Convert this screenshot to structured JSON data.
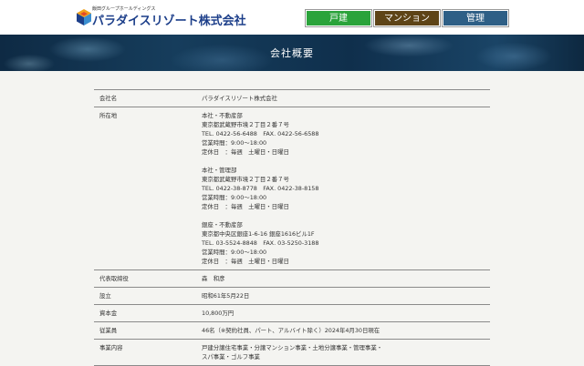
{
  "header": {
    "logo_sub": "飯田グループホールディングス",
    "logo_main": "パラダイスリゾート株式会社",
    "nav": [
      "戸建",
      "マンション",
      "管理"
    ]
  },
  "banner": {
    "title": "会社概要"
  },
  "table": {
    "rows": [
      {
        "label": "会社名",
        "value": "パラダイスリゾート株式会社"
      },
      {
        "label": "所在地",
        "offices": [
          {
            "lines": [
              "本社・不動産部",
              "東京都武蔵野市境２丁目２番７号",
              "TEL. 0422-56-6488　FAX. 0422-56-6588",
              "営業時間：9:00〜18:00",
              "定休日　：毎週　土曜日・日曜日"
            ]
          },
          {
            "lines": [
              "本社・管理部",
              "東京都武蔵野市境２丁目２番７号",
              "TEL. 0422-38-8778　FAX. 0422-38-8158",
              "営業時間：9:00〜18:00",
              "定休日　：毎週　土曜日・日曜日"
            ]
          },
          {
            "lines": [
              "銀座・不動産部",
              "東京都中央区銀座1-6-16 銀座1616ビル1F",
              "TEL. 03-5524-8848　FAX. 03-5250-3188",
              "営業時間：9:00〜18:00",
              "定休日　：毎週　土曜日・日曜日"
            ]
          }
        ]
      },
      {
        "label": "代表取締役",
        "value": "森　和彦"
      },
      {
        "label": "設立",
        "value": "昭和61年5月22日"
      },
      {
        "label": "資本金",
        "value": "10,800万円"
      },
      {
        "label": "従業員",
        "value": "46名（※契約社員、パート、アルバイト除く）2024年4月30日現在"
      },
      {
        "label": "事業内容",
        "lines": [
          "戸建分譲住宅事業・分譲マンション事業・土地分譲事業・管理事業・",
          "スパ事業・ゴルフ事業"
        ]
      }
    ]
  }
}
